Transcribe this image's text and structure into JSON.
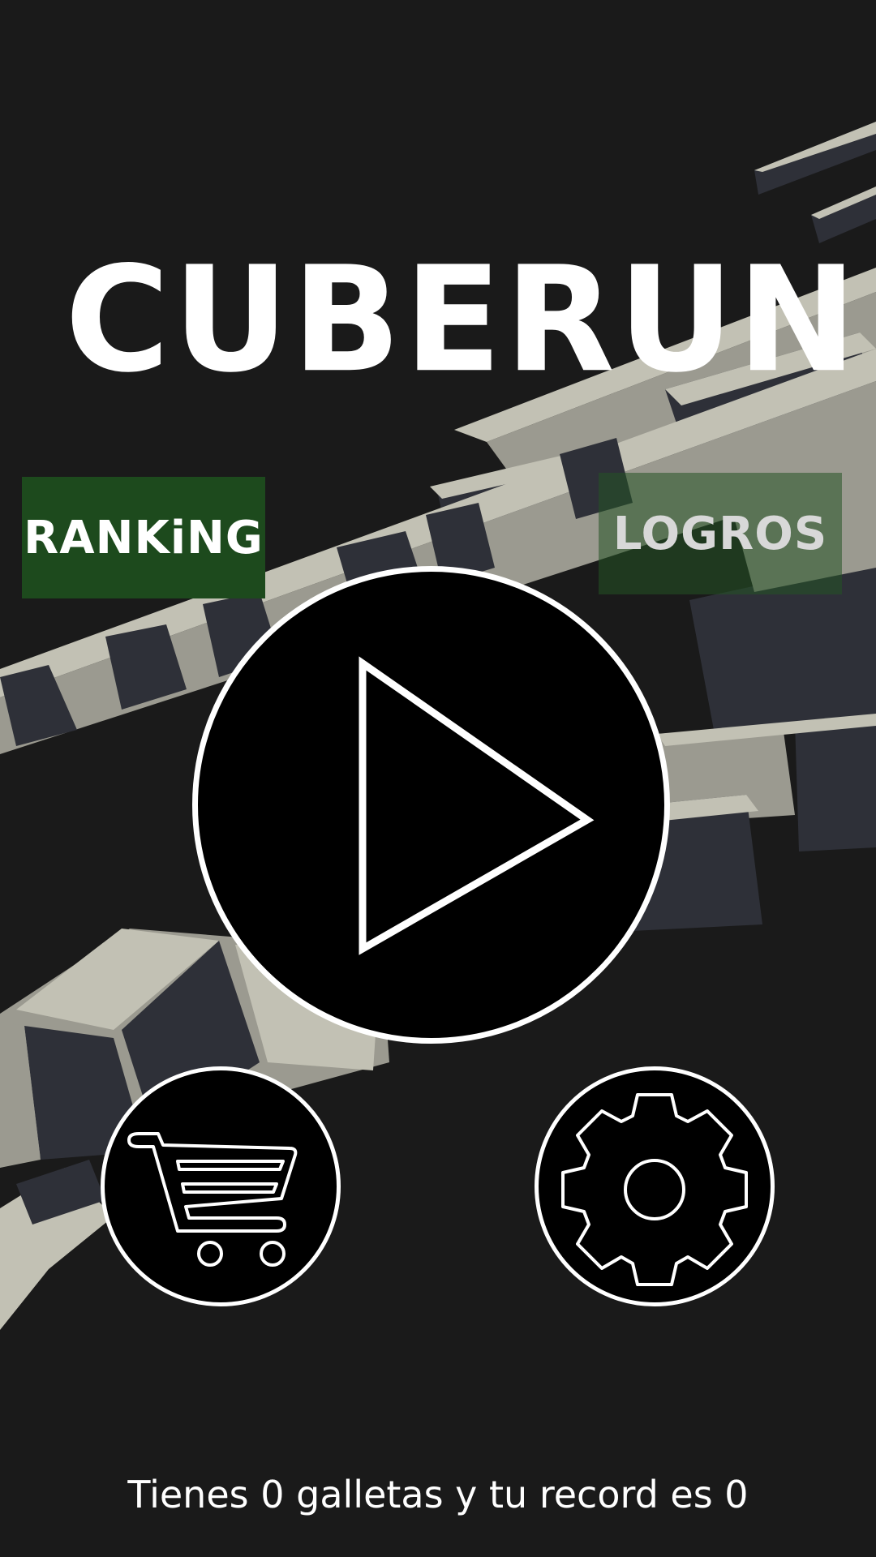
{
  "app": {
    "title": "CUBERUN"
  },
  "menu": {
    "ranking_label": "RANKiNG",
    "logros_label": "LOGROS"
  },
  "buttons": {
    "play_icon": "play-triangle-icon",
    "shop_icon": "shopping-cart-icon",
    "settings_icon": "gear-icon"
  },
  "status": {
    "message": "Tienes 0 galletas y tu record es 0",
    "cookies": 0,
    "record": 0
  },
  "colors": {
    "background": "#1a1a1a",
    "ranking_button": "#1d4a1d",
    "logros_button": "#245424",
    "cube_light": "#c2c1b4",
    "cube_mid": "#9b9a90",
    "cube_dark": "#2e3038",
    "foreground": "#ffffff"
  }
}
